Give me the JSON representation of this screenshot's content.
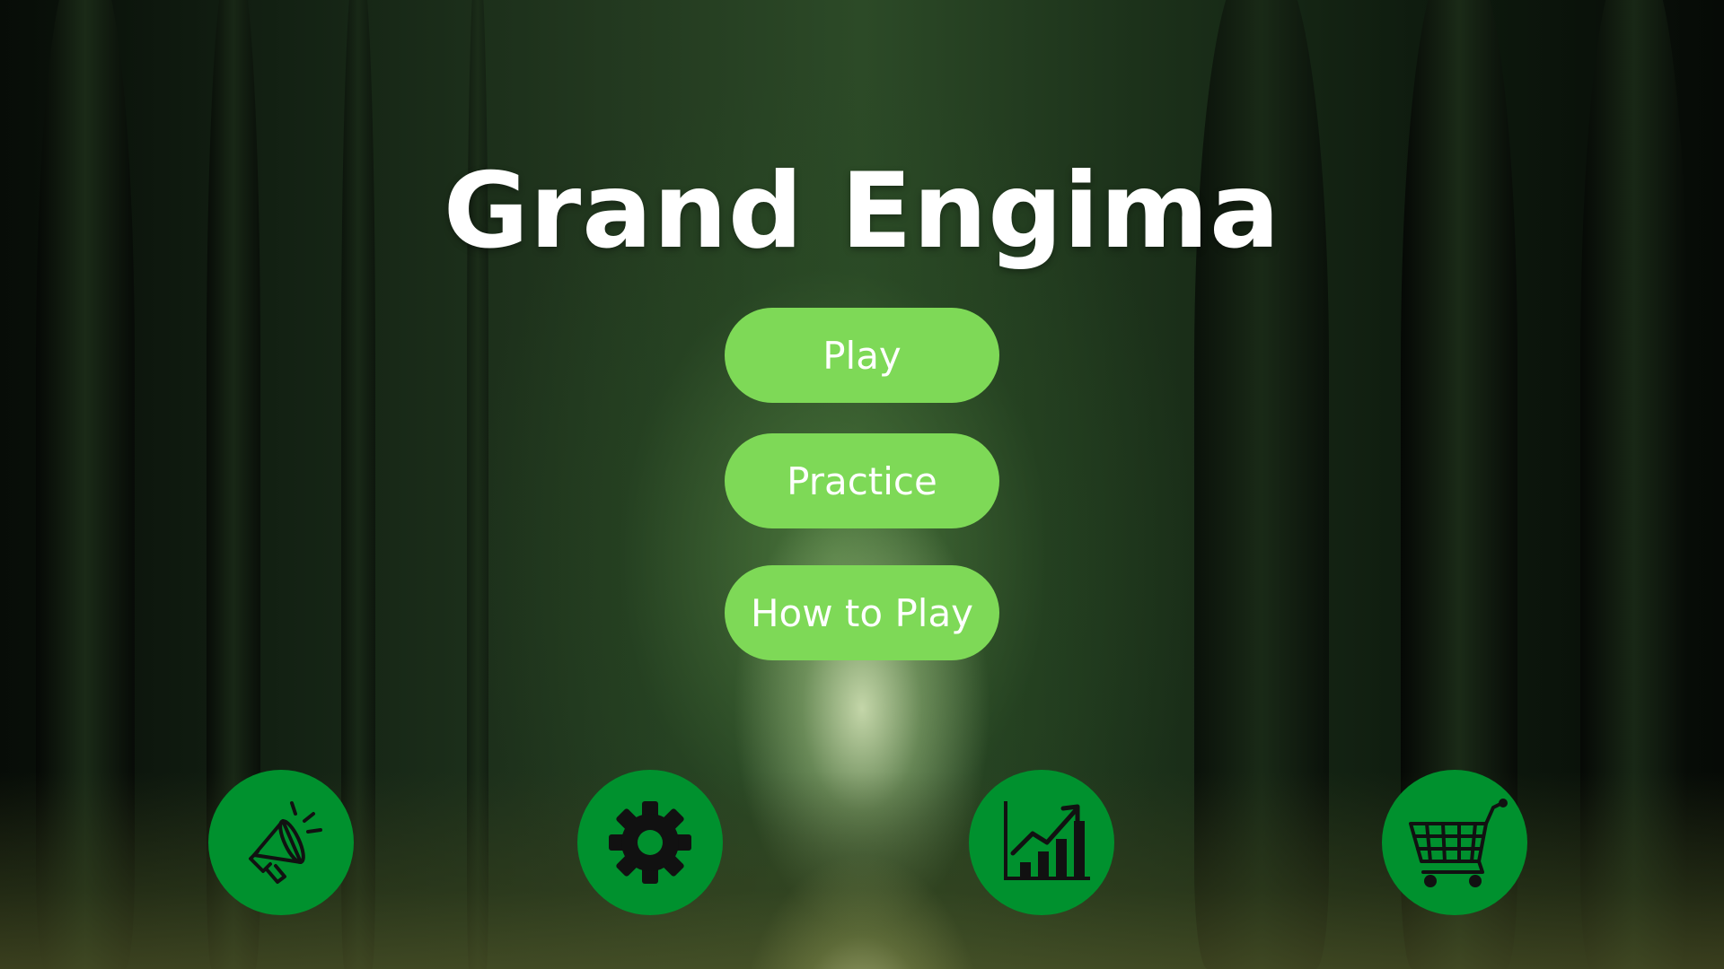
{
  "game": {
    "title": "Grand Engima"
  },
  "menu": {
    "play_label": "Play",
    "practice_label": "Practice",
    "how_to_play_label": "How to Play"
  },
  "bottom_bar": {
    "icons": [
      "megaphone-icon",
      "gear-icon",
      "chart-icon",
      "cart-icon"
    ]
  },
  "colors": {
    "menu_button": "#7ed957",
    "icon_button": "#00912e",
    "title_text": "#ffffff",
    "icon_glyph": "#111111"
  }
}
